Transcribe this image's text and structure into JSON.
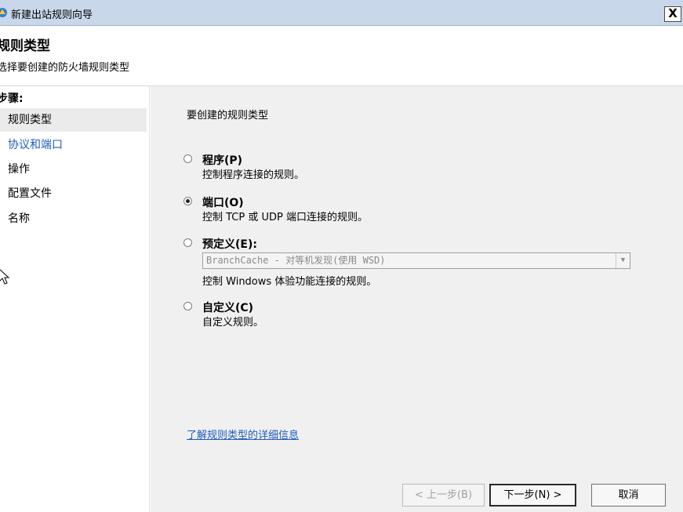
{
  "window": {
    "title": "新建出站规则向导",
    "close_label": "X"
  },
  "header": {
    "title": "规则类型",
    "subtitle": "选择要创建的防火墙规则类型"
  },
  "steps": {
    "title": "步骤:",
    "items": [
      {
        "label": "规则类型",
        "state": "current"
      },
      {
        "label": "协议和端口",
        "state": "link"
      },
      {
        "label": "操作",
        "state": "normal"
      },
      {
        "label": "配置文件",
        "state": "normal"
      },
      {
        "label": "名称",
        "state": "normal"
      }
    ]
  },
  "main": {
    "prompt": "要创建的规则类型",
    "options": [
      {
        "label": "程序(P)",
        "desc": "控制程序连接的规则。",
        "checked": false
      },
      {
        "label": "端口(O)",
        "desc": "控制 TCP 或 UDP 端口连接的规则。",
        "checked": true
      },
      {
        "label": "预定义(E):",
        "desc": "",
        "checked": false
      },
      {
        "label": "自定义(C)",
        "desc": "自定义规则。",
        "checked": false
      }
    ],
    "predefined_select_value": "BranchCache - 对等机发现(使用 WSD)",
    "predefined_desc": "控制 Windows 体验功能连接的规则。",
    "learn_more": "了解规则类型的详细信息"
  },
  "buttons": {
    "back": "< 上一步(B)",
    "next": "下一步(N) >",
    "cancel": "取消"
  },
  "colors": {
    "titlebar": "#c9d7ea",
    "link": "#1e5bbf",
    "panel": "#f0f0f0"
  }
}
